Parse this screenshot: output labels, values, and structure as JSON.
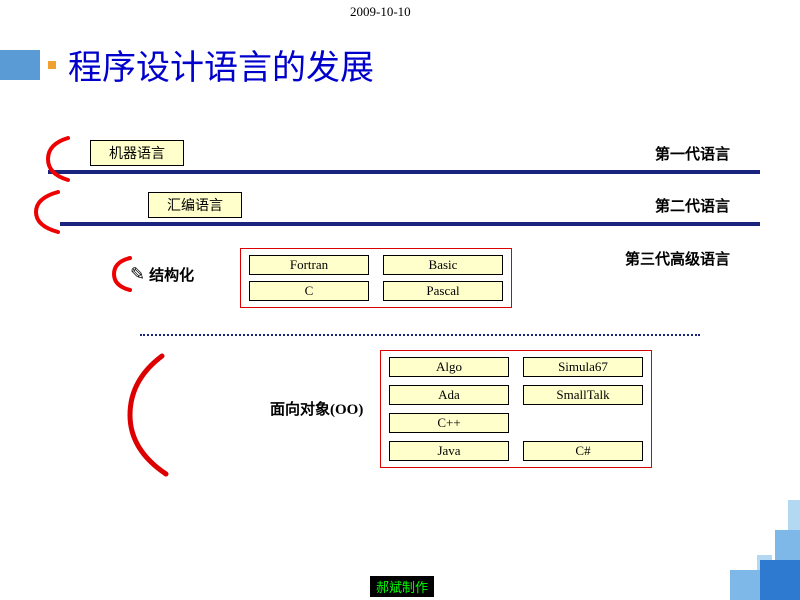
{
  "date": "2009-10-10",
  "title": "程序设计语言的发展",
  "gen1": {
    "lang": "机器语言",
    "label": "第一代语言"
  },
  "gen2": {
    "lang": "汇编语言",
    "label": "第二代语言"
  },
  "gen3": {
    "label": "第三代高级语言",
    "structLabel": "结构化",
    "ooLabel": "面向对象(OO)",
    "structLangs": [
      "Fortran",
      "Basic",
      "C",
      "Pascal"
    ],
    "ooLangs": [
      "Algo",
      "Simula67",
      "Ada",
      "SmallTalk",
      "C++",
      "",
      "Java",
      "C#"
    ]
  },
  "footer": "郝斌制作"
}
